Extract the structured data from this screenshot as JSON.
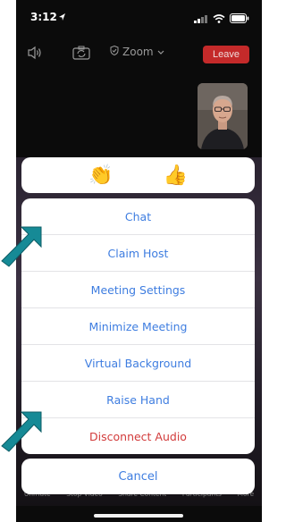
{
  "status": {
    "time": "3:12"
  },
  "toolbar": {
    "title": "Zoom",
    "leave": "Leave"
  },
  "reactions": [
    {
      "emoji": "👏"
    },
    {
      "emoji": "👍"
    }
  ],
  "menu": {
    "items": [
      {
        "label": "Chat"
      },
      {
        "label": "Claim Host"
      },
      {
        "label": "Meeting Settings"
      },
      {
        "label": "Minimize Meeting"
      },
      {
        "label": "Virtual Background"
      },
      {
        "label": "Raise Hand"
      },
      {
        "label": "Disconnect Audio"
      }
    ],
    "cancel": "Cancel"
  },
  "bottom_bar": {
    "labels": [
      "Unmute",
      "Stop Video",
      "Share Content",
      "Participants",
      "More"
    ]
  },
  "colors": {
    "accent": "#3e7de0",
    "danger": "#d23b3b",
    "leave": "#c42a2a",
    "annotation_arrow": "#168a96"
  }
}
